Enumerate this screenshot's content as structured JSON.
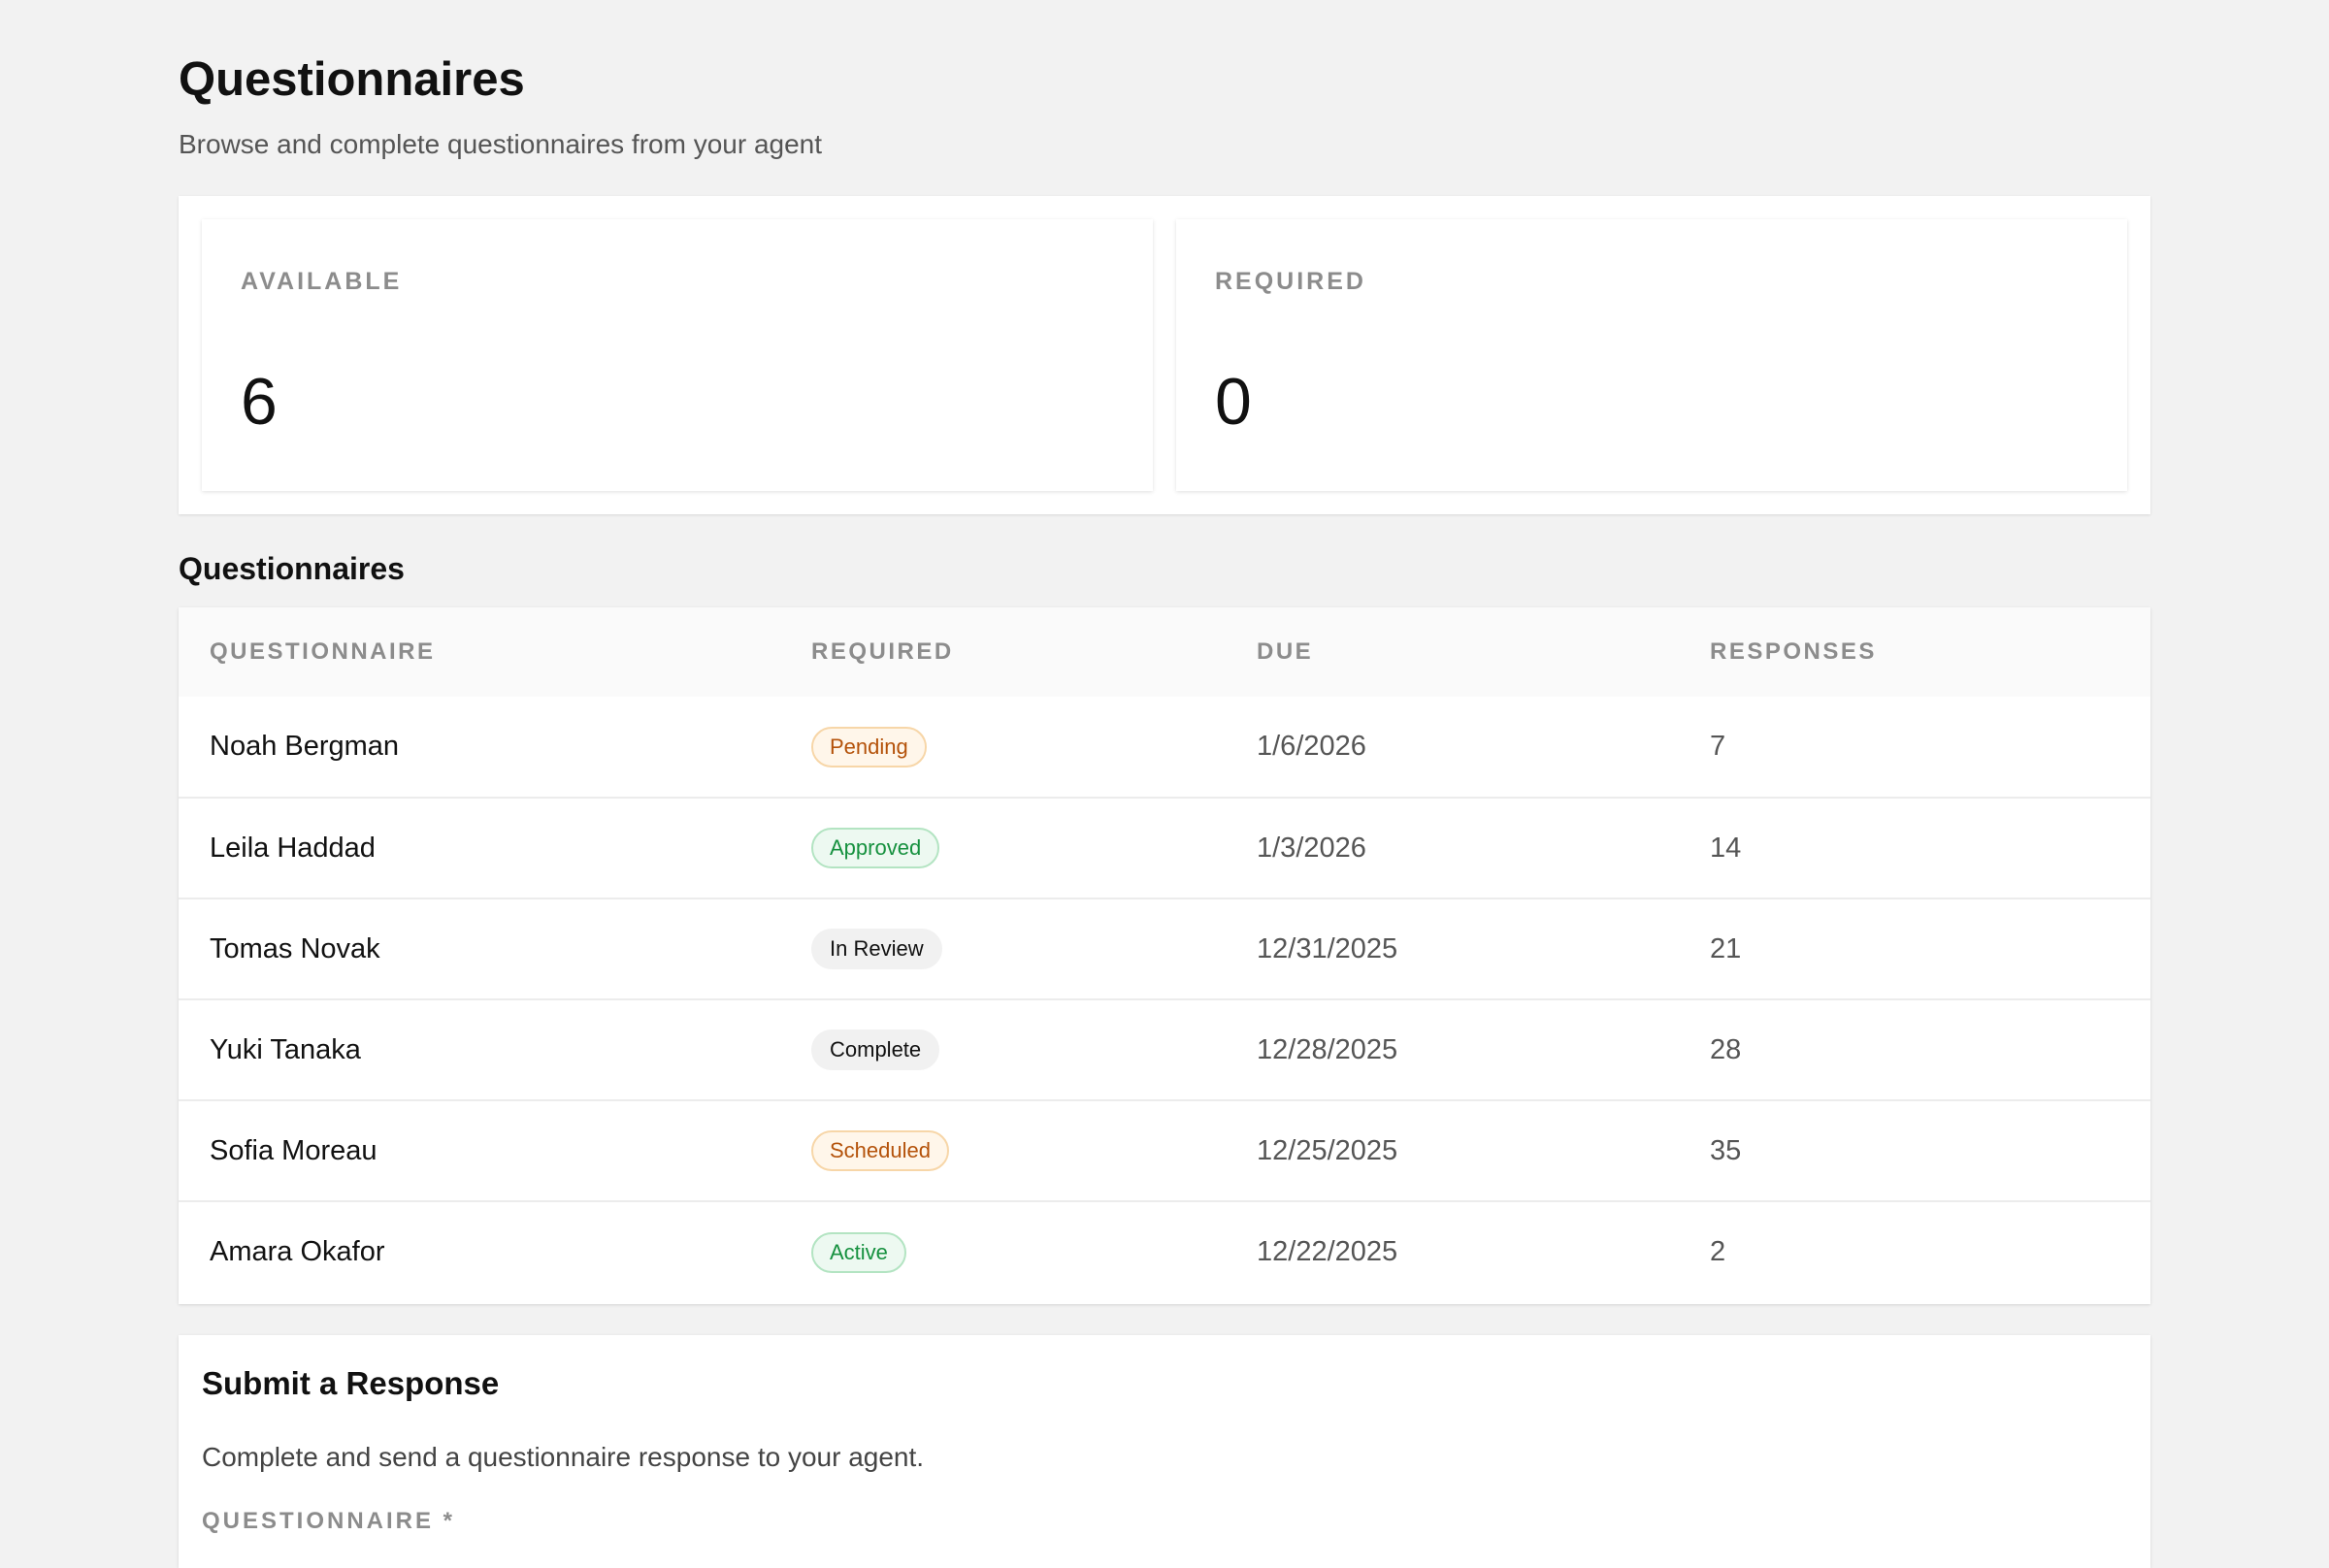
{
  "header": {
    "title": "Questionnaires",
    "subtitle": "Browse and complete questionnaires from your agent"
  },
  "stats": [
    {
      "label": "AVAILABLE",
      "value": "6"
    },
    {
      "label": "REQUIRED",
      "value": "0"
    }
  ],
  "table": {
    "section_title": "Questionnaires",
    "columns": [
      "QUESTIONNAIRE",
      "REQUIRED",
      "DUE",
      "RESPONSES"
    ],
    "rows": [
      {
        "name": "Noah Bergman",
        "status": "Pending",
        "status_kind": "pending",
        "due": "1/6/2026",
        "responses": "7"
      },
      {
        "name": "Leila Haddad",
        "status": "Approved",
        "status_kind": "approved",
        "due": "1/3/2026",
        "responses": "14"
      },
      {
        "name": "Tomas Novak",
        "status": "In Review",
        "status_kind": "neutral",
        "due": "12/31/2025",
        "responses": "21"
      },
      {
        "name": "Yuki Tanaka",
        "status": "Complete",
        "status_kind": "neutral",
        "due": "12/28/2025",
        "responses": "28"
      },
      {
        "name": "Sofia Moreau",
        "status": "Scheduled",
        "status_kind": "pending",
        "due": "12/25/2025",
        "responses": "35"
      },
      {
        "name": "Amara Okafor",
        "status": "Active",
        "status_kind": "approved",
        "due": "12/22/2025",
        "responses": "2"
      }
    ]
  },
  "submit": {
    "title": "Submit a Response",
    "description": "Complete and send a questionnaire response to your agent.",
    "questionnaire_label": "QUESTIONNAIRE *"
  },
  "colors": {
    "background": "#f2f2f2",
    "card": "#ffffff",
    "pending_text": "#b4520a",
    "pending_bg": "#fff6ea",
    "approved_text": "#16913f",
    "approved_bg": "#edf9f1",
    "neutral_bg": "#f1f1f1"
  }
}
